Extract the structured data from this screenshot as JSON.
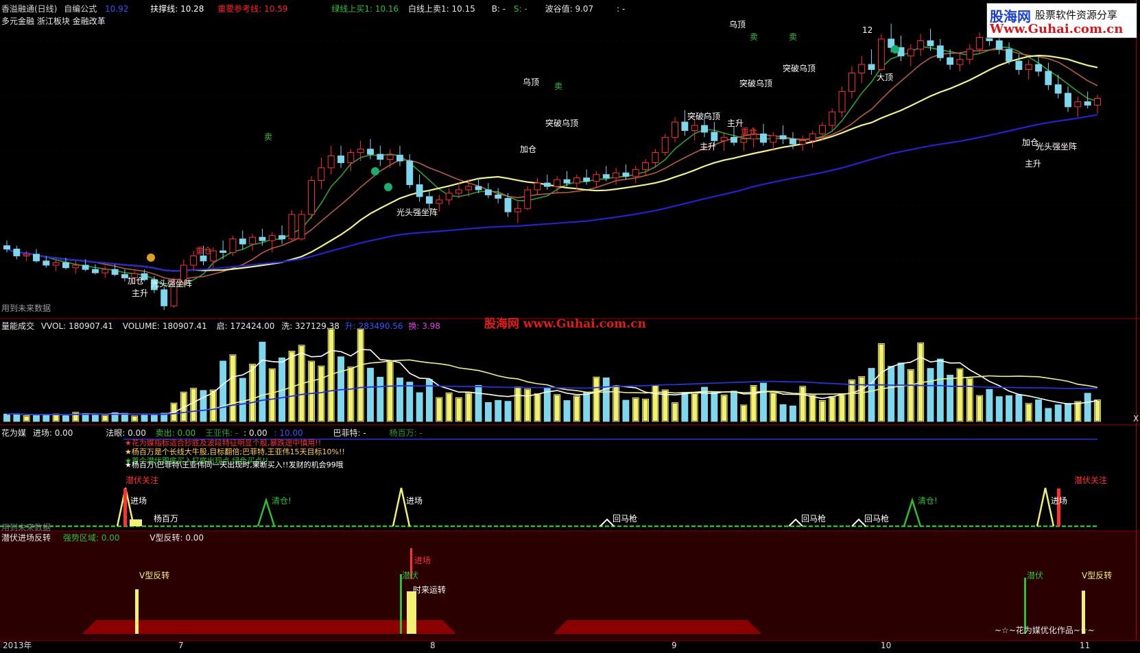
{
  "header": {
    "title": "香溢融通(日线)",
    "formula": "自编公式",
    "price": "10.92",
    "support": "扶撑线: 10.28",
    "important_ref": "重要参考线: 10.59",
    "green_buy": "绿线上买1: 10.16",
    "white_sell": "白线上卖1: 10.15",
    "b": "B: -",
    "s": "S: -",
    "wave_value": "波谷值: 9.07",
    "dash": ": -",
    "concepts": "多元金融 浙江板块 金融改革"
  },
  "watermark": {
    "brand": "股海网",
    "slogan": "股票软件资源分享",
    "url": "Www.Guhai.com.cn",
    "mid": "股海网  www.Guhai.com.cn"
  },
  "colors": {
    "up": "#ff3030",
    "down": "#7fd7ee",
    "ma_green": "#2ea02e",
    "ma_brown": "#b85c3c",
    "ma_yellow": "#f2f28a",
    "ma_blue": "#2222d8",
    "divider": "#a00000"
  },
  "panel1": {
    "future_note": "用到未来数据",
    "annotations": [
      "乌顶",
      "乌顶",
      "突破乌顶",
      "突破乌顶",
      "突破乌顶",
      "突破乌顶",
      "大顶",
      "主升",
      "主升",
      "主升",
      "主升",
      "加仓",
      "加仓",
      "加仓",
      "重仓",
      "重仓",
      "光头强坐阵",
      "光头强坐阵",
      "光头强坐阵",
      "卖",
      "卖",
      "卖",
      "卖",
      "12"
    ]
  },
  "panel2": {
    "label": "量能成交",
    "vvol": "VVOL: 180907.41",
    "volume": "VOLUME: 180907.41",
    "qi": "启: 172424.00",
    "xi": "洗: 327129.38",
    "sheng": "升: 283490.56",
    "huan": "换: 3.98",
    "right_mark": "X"
  },
  "panel3": {
    "label": "花为媒",
    "entry": "进场: 0.00",
    "fayan": "法眼: 0.00",
    "sell": "卖出: 0.00",
    "wang": "王亚伟: -",
    "wang_v1": ": 0.00",
    "wang_v2": ": 10.00",
    "buffett": "巴菲特: -",
    "yang": "杨百万: -",
    "notes": [
      "★花为媒指标适合抄底及波段特征明显个股,暴跌途中慎用!!",
      "★杨百万是个长线大牛股,目标翻倍;巴菲特,王亚伟15天目标10%!!",
      "★首个潜伏跟底买入打底出现点,绿色买点!!",
      "★杨百万\\巴菲特\\王亚伟同一天出现时,果断买入!!发财的机会99哦"
    ],
    "signals": [
      "潜伏关注",
      "进场",
      "杨百万",
      "清仓!",
      "进场",
      "回马枪",
      "回马枪",
      "回马枪",
      "清仓!",
      "潜伏关注",
      "进场"
    ],
    "future_note": "用到未来数据"
  },
  "panel4": {
    "label": "潜伏进场反转",
    "strong_zone": "强势区域: 0.00",
    "v_reversal": "V型反转: 0.00",
    "signals": [
      "V型反转",
      "进场",
      "潜伏",
      "时来运转",
      "潜伏",
      "V型反转"
    ],
    "credit": "~☆~花为媒优化作品~☆~"
  },
  "xaxis": {
    "labels": [
      "2013年",
      "7",
      "8",
      "9",
      "10",
      "11"
    ]
  },
  "chart_data": {
    "type": "line",
    "note": "candlestick",
    "candles": [
      [
        9.78,
        9.84,
        9.7,
        9.74
      ],
      [
        9.74,
        9.78,
        9.62,
        9.66
      ],
      [
        9.66,
        9.72,
        9.6,
        9.68
      ],
      [
        9.68,
        9.74,
        9.58,
        9.6
      ],
      [
        9.6,
        9.66,
        9.52,
        9.55
      ],
      [
        9.55,
        9.62,
        9.48,
        9.58
      ],
      [
        9.58,
        9.64,
        9.5,
        9.52
      ],
      [
        9.52,
        9.6,
        9.45,
        9.55
      ],
      [
        9.55,
        9.62,
        9.48,
        9.5
      ],
      [
        9.5,
        9.56,
        9.44,
        9.46
      ],
      [
        9.46,
        9.54,
        9.4,
        9.5
      ],
      [
        9.5,
        9.56,
        9.42,
        9.44
      ],
      [
        9.44,
        9.5,
        9.36,
        9.4
      ],
      [
        9.4,
        9.48,
        9.34,
        9.45
      ],
      [
        9.45,
        9.5,
        9.36,
        9.38
      ],
      [
        9.38,
        9.42,
        9.22,
        9.26
      ],
      [
        9.26,
        9.3,
        9.02,
        9.07
      ],
      [
        9.07,
        9.4,
        9.05,
        9.35
      ],
      [
        9.35,
        9.62,
        9.3,
        9.55
      ],
      [
        9.55,
        9.72,
        9.48,
        9.66
      ],
      [
        9.66,
        9.78,
        9.55,
        9.6
      ],
      [
        9.6,
        9.76,
        9.52,
        9.72
      ],
      [
        9.72,
        9.84,
        9.62,
        9.7
      ],
      [
        9.7,
        9.9,
        9.66,
        9.86
      ],
      [
        9.86,
        9.96,
        9.74,
        9.8
      ],
      [
        9.8,
        9.92,
        9.72,
        9.88
      ],
      [
        9.88,
        9.98,
        9.78,
        9.84
      ],
      [
        9.84,
        9.94,
        9.7,
        9.9
      ],
      [
        9.9,
        10.02,
        9.8,
        9.86
      ],
      [
        9.86,
        10.2,
        9.84,
        10.15
      ],
      [
        9.86,
        10.2,
        9.84,
        10.15
      ],
      [
        10.15,
        10.6,
        10.1,
        10.55
      ],
      [
        10.55,
        10.82,
        10.45,
        10.7
      ],
      [
        10.7,
        10.96,
        10.62,
        10.84
      ],
      [
        10.84,
        10.96,
        10.7,
        10.76
      ],
      [
        10.76,
        10.92,
        10.66,
        10.88
      ],
      [
        10.88,
        11.02,
        10.78,
        10.92
      ],
      [
        10.92,
        11.04,
        10.8,
        10.86
      ],
      [
        10.86,
        10.96,
        10.72,
        10.8
      ],
      [
        10.8,
        10.92,
        10.7,
        10.85
      ],
      [
        10.85,
        10.96,
        10.72,
        10.78
      ],
      [
        10.78,
        10.86,
        10.46,
        10.5
      ],
      [
        10.5,
        10.62,
        10.3,
        10.36
      ],
      [
        10.36,
        10.44,
        10.2,
        10.28
      ],
      [
        10.28,
        10.38,
        10.18,
        10.32
      ],
      [
        10.32,
        10.46,
        10.26,
        10.4
      ],
      [
        10.4,
        10.52,
        10.34,
        10.44
      ],
      [
        10.44,
        10.56,
        10.36,
        10.48
      ],
      [
        10.48,
        10.58,
        10.4,
        10.44
      ],
      [
        10.44,
        10.52,
        10.34,
        10.38
      ],
      [
        10.38,
        10.46,
        10.28,
        10.34
      ],
      [
        10.34,
        10.4,
        10.12,
        10.18
      ],
      [
        10.18,
        10.3,
        10.05,
        10.22
      ],
      [
        10.22,
        10.48,
        10.2,
        10.44
      ],
      [
        10.44,
        10.58,
        10.38,
        10.52
      ],
      [
        10.52,
        10.62,
        10.44,
        10.48
      ],
      [
        10.48,
        10.6,
        10.4,
        10.56
      ],
      [
        10.56,
        10.66,
        10.48,
        10.52
      ],
      [
        10.52,
        10.62,
        10.44,
        10.58
      ],
      [
        10.58,
        10.68,
        10.5,
        10.54
      ],
      [
        10.54,
        10.66,
        10.46,
        10.62
      ],
      [
        10.62,
        10.72,
        10.54,
        10.58
      ],
      [
        10.58,
        10.7,
        10.5,
        10.64
      ],
      [
        10.64,
        10.74,
        10.56,
        10.6
      ],
      [
        10.6,
        10.72,
        10.52,
        10.68
      ],
      [
        10.68,
        10.8,
        10.6,
        10.76
      ],
      [
        10.76,
        10.92,
        10.7,
        10.88
      ],
      [
        10.88,
        11.1,
        10.84,
        11.06
      ],
      [
        11.06,
        11.3,
        11.0,
        11.24
      ],
      [
        11.24,
        11.38,
        11.08,
        11.14
      ],
      [
        11.14,
        11.28,
        11.02,
        11.2
      ],
      [
        11.2,
        11.34,
        11.06,
        11.12
      ],
      [
        11.12,
        11.24,
        10.96,
        11.02
      ],
      [
        11.02,
        11.12,
        10.9,
        11.06
      ],
      [
        11.06,
        11.18,
        10.96,
        11.0
      ],
      [
        11.0,
        11.1,
        10.9,
        11.04
      ],
      [
        11.04,
        11.16,
        10.94,
        11.1
      ],
      [
        11.1,
        11.22,
        10.96,
        11.0
      ],
      [
        11.0,
        11.12,
        10.9,
        11.08
      ],
      [
        11.08,
        11.2,
        10.98,
        11.04
      ],
      [
        11.04,
        11.12,
        10.92,
        10.98
      ],
      [
        10.98,
        11.08,
        10.9,
        11.02
      ],
      [
        11.02,
        11.14,
        10.94,
        11.1
      ],
      [
        11.1,
        11.24,
        11.02,
        11.2
      ],
      [
        11.2,
        11.4,
        11.14,
        11.36
      ],
      [
        11.36,
        11.66,
        11.3,
        11.6
      ],
      [
        11.6,
        11.9,
        11.52,
        11.82
      ],
      [
        11.82,
        12.02,
        11.7,
        11.92
      ],
      [
        11.92,
        12.1,
        11.8,
        11.86
      ],
      [
        11.86,
        12.28,
        11.84,
        12.22
      ],
      [
        12.22,
        12.4,
        12.06,
        12.12
      ],
      [
        12.12,
        12.26,
        11.96,
        12.02
      ],
      [
        12.02,
        12.16,
        11.9,
        12.1
      ],
      [
        12.1,
        12.28,
        12.02,
        12.2
      ],
      [
        12.2,
        12.34,
        12.08,
        12.14
      ],
      [
        12.14,
        12.22,
        11.96,
        12.0
      ],
      [
        12.0,
        12.1,
        11.86,
        11.92
      ],
      [
        11.92,
        12.04,
        11.84,
        11.98
      ],
      [
        11.98,
        12.16,
        11.92,
        12.1
      ],
      [
        12.1,
        12.3,
        12.04,
        12.24
      ],
      [
        12.24,
        12.36,
        12.14,
        12.2
      ],
      [
        12.2,
        12.32,
        12.04,
        12.1
      ],
      [
        12.1,
        12.18,
        11.92,
        11.96
      ],
      [
        11.96,
        12.04,
        11.8,
        11.86
      ],
      [
        11.86,
        11.98,
        11.74,
        11.92
      ],
      [
        11.92,
        12.02,
        11.78,
        11.84
      ],
      [
        11.84,
        11.94,
        11.62,
        11.68
      ],
      [
        11.68,
        11.8,
        11.52,
        11.58
      ],
      [
        11.58,
        11.66,
        11.36,
        11.42
      ],
      [
        11.42,
        11.54,
        11.3,
        11.48
      ],
      [
        11.48,
        11.6,
        11.4,
        11.44
      ],
      [
        11.44,
        11.56,
        11.34,
        11.52
      ]
    ]
  }
}
